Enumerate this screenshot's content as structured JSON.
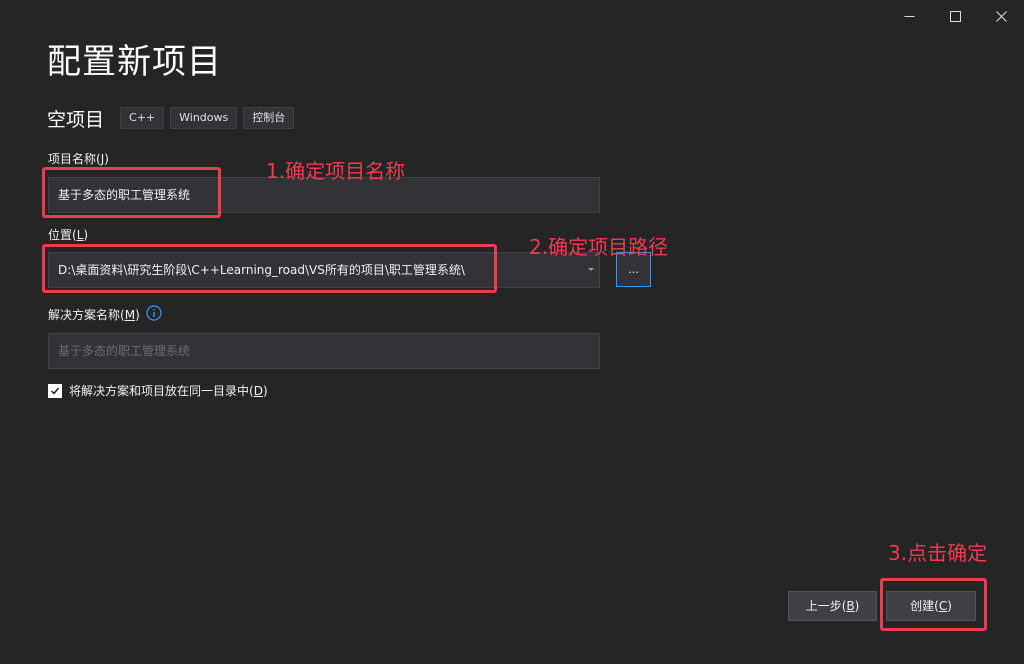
{
  "window": {
    "controls": [
      "minimize-icon",
      "maximize-icon",
      "close-icon"
    ]
  },
  "page": {
    "title": "配置新项目"
  },
  "template": {
    "name": "空项目",
    "tags": [
      "C++",
      "Windows",
      "控制台"
    ]
  },
  "form": {
    "project_name": {
      "label": "项目名称",
      "accesskey": "J",
      "value": "基于多态的职工管理系统"
    },
    "location": {
      "label": "位置",
      "accesskey": "L",
      "value": "D:\\桌面资料\\研究生阶段\\C++Learning_road\\VS所有的项目\\职工管理系统\\",
      "browse_label": "..."
    },
    "solution_name": {
      "label": "解决方案名称",
      "accesskey": "M",
      "placeholder": "基于多态的职工管理系统",
      "info_icon": "info-icon"
    },
    "same_dir": {
      "label": "将解决方案和项目放在同一目录中",
      "accesskey": "D",
      "checked": true
    }
  },
  "buttons": {
    "back": {
      "label": "上一步",
      "accesskey": "B"
    },
    "create": {
      "label": "创建",
      "accesskey": "C"
    }
  },
  "annotations": {
    "step1": "1.确定项目名称",
    "step2": "2.确定项目路径",
    "step3": "3.点击确定",
    "color": "#ee3b52"
  },
  "colors": {
    "background": "#252526",
    "input_bg": "#333337",
    "accent": "#3399ff"
  }
}
